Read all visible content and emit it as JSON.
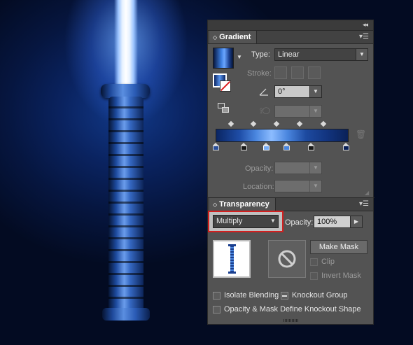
{
  "gradient_panel": {
    "tab_label": "Gradient",
    "type_label": "Type:",
    "type_value": "Linear",
    "stroke_label": "Stroke:",
    "angle_value": "0°",
    "opacity_label": "Opacity:",
    "location_label": "Location:"
  },
  "transparency_panel": {
    "tab_label": "Transparency",
    "blend_mode": "Multiply",
    "opacity_label": "Opacity:",
    "opacity_value": "100%",
    "make_mask_label": "Make Mask",
    "clip_label": "Clip",
    "invert_mask_label": "Invert Mask",
    "isolate_blending_label": "Isolate Blending",
    "knockout_group_label": "Knockout Group",
    "opacity_mask_label": "Opacity & Mask Define Knockout Shape"
  },
  "colors": {
    "highlight_border": "#d31f1f",
    "panel_bg": "#535353"
  }
}
